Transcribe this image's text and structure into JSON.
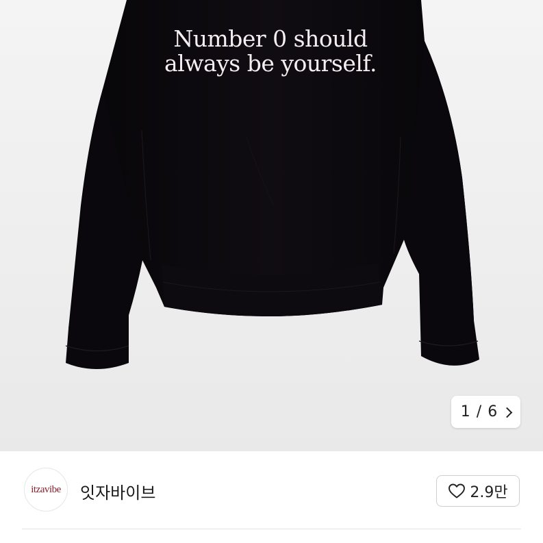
{
  "gallery": {
    "print_line_1": "Number 0 should",
    "print_line_2": "always be yourself.",
    "page_indicator": "1 / 6",
    "chevron_icon": "chevron-right-icon"
  },
  "seller": {
    "avatar_text": "itzavibe",
    "name": "잇자바이브",
    "like_icon": "heart-icon",
    "like_count": "2.9만"
  },
  "colors": {
    "sweatshirt": "#0b090d",
    "print_text": "#f3eef0",
    "avatar_text": "#8c1f2c",
    "background": "#ffffff"
  }
}
